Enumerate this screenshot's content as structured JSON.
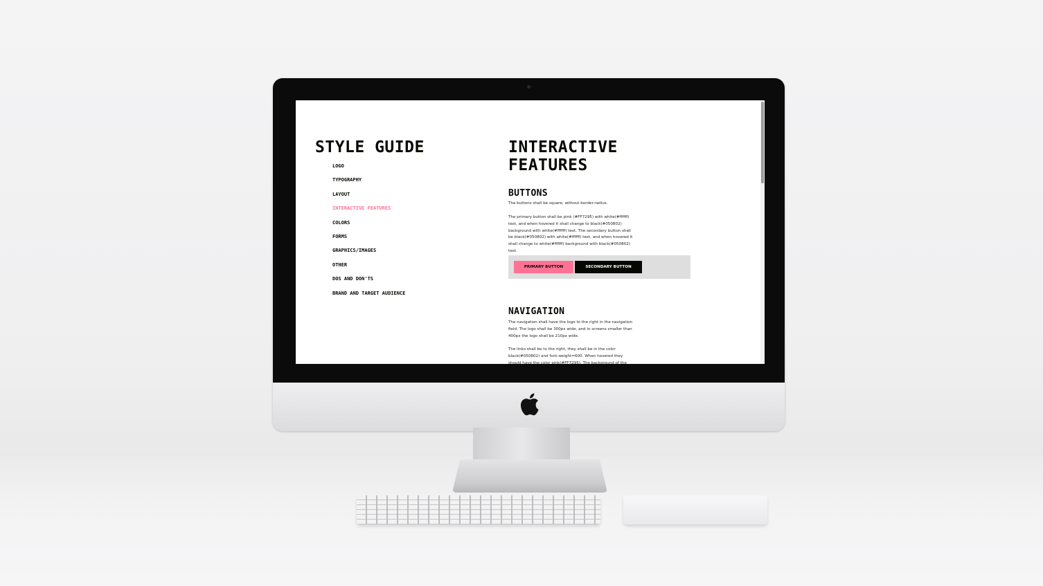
{
  "colors": {
    "accent_pink": "#ff7295",
    "text_black": "#050802",
    "white": "#ffffff",
    "button_panel_bg": "#dedede"
  },
  "sidebar": {
    "title": "STYLE GUIDE",
    "items": [
      {
        "label": "LOGO",
        "active": false
      },
      {
        "label": "TYPOGRAPHY",
        "active": false
      },
      {
        "label": "LAYOUT",
        "active": false
      },
      {
        "label": "INTERACTIVE FEATURES",
        "active": true
      },
      {
        "label": "COLORS",
        "active": false
      },
      {
        "label": "FORMS",
        "active": false
      },
      {
        "label": "GRAPHICS/IMAGES",
        "active": false
      },
      {
        "label": "OTHER",
        "active": false
      },
      {
        "label": "DOS AND DON'TS",
        "active": false
      },
      {
        "label": "BRAND AND TARGET AUDIENCE",
        "active": false
      }
    ]
  },
  "main": {
    "title_line1": "INTERACTIVE",
    "title_line2": "FEATURES",
    "buttons_section": {
      "heading": "BUTTONS",
      "para1": "The buttons shall be square, without border-radius.",
      "para2": "The primary button shall be pink (#FF7295) with white(#ffffff) text, and when hovered it shall change to black(#050802) background with white(#ffffff) text. The secondary button shall be black(#050802) with white(#ffffff) text, and when hovered it shall change to white(#ffffff) background with black(#050802) text.",
      "primary_label": "PRIMARY BUTTON",
      "secondary_label": "SECONDARY BUTTON"
    },
    "navigation_section": {
      "heading": "NAVIGATION",
      "para1": "The navigation shall have the logo to the right in the navigation field. The logo shall be 300px wide, and in screens smaller than 400px the logo shall be 210px wide.",
      "para2": "The links shall be to the right, they shall be in the color black(#050802) and font-weight=600. When hovered they should have the color pink(#FF7295). The background of the navigation"
    }
  }
}
